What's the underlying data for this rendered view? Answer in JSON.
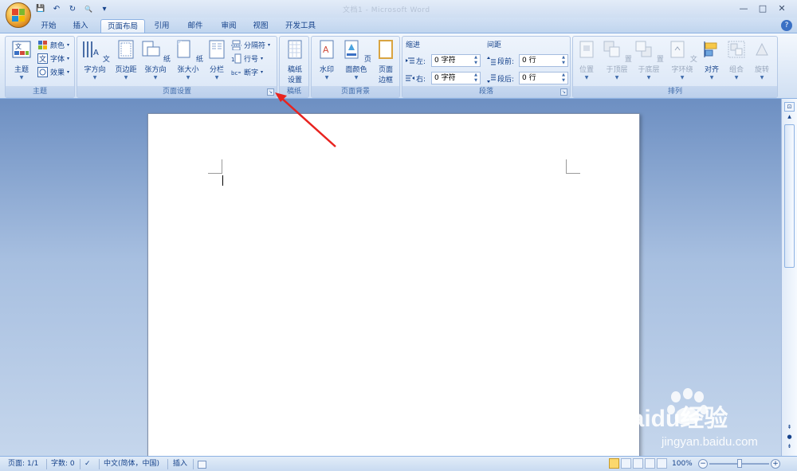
{
  "window": {
    "title": "文档1 - Microsoft Word",
    "min": "—",
    "max": "□",
    "close": "✕"
  },
  "qat": {
    "save": "💾",
    "undo": "↶",
    "repeat": "↻",
    "preview": "🔍",
    "customize": "▾"
  },
  "tabs": [
    "开始",
    "插入",
    "页面布局",
    "引用",
    "邮件",
    "审阅",
    "视图",
    "开发工具"
  ],
  "active_tab": "页面布局",
  "help": "?",
  "groups": {
    "theme": {
      "label": "主题",
      "theme_btn": "主题",
      "colors": "颜色",
      "fonts": "字体",
      "effects": "效果"
    },
    "page_setup": {
      "label": "页面设置",
      "text_direction": "文字方向",
      "margins": "页边距",
      "orientation": "纸张方向",
      "size": "纸张大小",
      "columns": "分栏",
      "breaks": "分隔符",
      "line_numbers": "行号",
      "hyphenation": "断字",
      "launcher": "↘"
    },
    "manuscript": {
      "label": "稿纸",
      "btn_line1": "稿纸",
      "btn_line2": "设置"
    },
    "page_background": {
      "label": "页面背景",
      "watermark": "水印",
      "page_color": "页面颜色",
      "border_line1": "页面",
      "border_line2": "边框"
    },
    "paragraph": {
      "label": "段落",
      "indent_header": "缩进",
      "spacing_header": "间距",
      "left_label": "左:",
      "right_label": "右:",
      "left_value": "0 字符",
      "right_value": "0 字符",
      "before_label": "段前:",
      "after_label": "段后:",
      "before_value": "0 行",
      "after_value": "0 行"
    },
    "arrange": {
      "label": "排列",
      "position": "位置",
      "bring_front": "置于顶层",
      "send_back": "置于底层",
      "wrap": "文字环绕",
      "align": "对齐",
      "group": "组合",
      "rotate": "旋转"
    }
  },
  "status": {
    "page": "页面: 1/1",
    "words": "字数: 0",
    "language": "中文(简体，中国)",
    "mode": "插入",
    "zoom": "100%",
    "zoom_minus": "−",
    "zoom_plus": "+"
  },
  "watermark": {
    "brand": "Baidu经验",
    "url": "jingyan.baidu.com"
  },
  "colors": {
    "accent": "#15428b",
    "annotation_arrow": "#e8231f",
    "ribbon_border": "#8db2e3"
  }
}
